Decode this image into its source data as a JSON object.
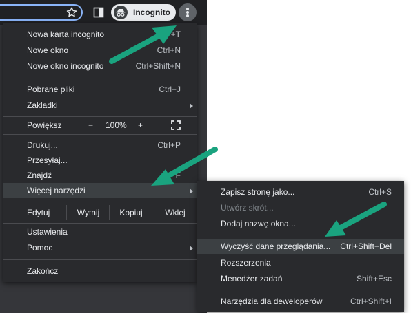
{
  "toolbar": {
    "incognito_label": "Incognito",
    "star_icon": "star-outline-icon",
    "side_panel_icon": "side-panel-icon",
    "incognito_icon": "incognito-icon",
    "menu_icon": "three-dots-vertical-icon"
  },
  "main_menu": {
    "new_incognito_tab": {
      "label": "Nowa karta incognito",
      "shortcut": "+T"
    },
    "new_window": {
      "label": "Nowe okno",
      "shortcut": "Ctrl+N"
    },
    "new_incognito_window": {
      "label": "Nowe okno incognito",
      "shortcut": "Ctrl+Shift+N"
    },
    "downloads": {
      "label": "Pobrane pliki",
      "shortcut": "Ctrl+J"
    },
    "bookmarks": {
      "label": "Zakładki"
    },
    "zoom": {
      "label": "Powiększ",
      "minus": "−",
      "value": "100%",
      "plus": "+"
    },
    "print": {
      "label": "Drukuj...",
      "shortcut": "Ctrl+P"
    },
    "cast": {
      "label": "Przesyłaj..."
    },
    "find": {
      "label": "Znajdź",
      "shortcut": "F"
    },
    "more_tools": {
      "label": "Więcej narzędzi"
    },
    "edit": {
      "label": "Edytuj",
      "cut": "Wytnij",
      "copy": "Kopiuj",
      "paste": "Wklej"
    },
    "settings": {
      "label": "Ustawienia"
    },
    "help": {
      "label": "Pomoc"
    },
    "exit": {
      "label": "Zakończ"
    }
  },
  "sub_menu": {
    "save_page": {
      "label": "Zapisz stronę jako...",
      "shortcut": "Ctrl+S"
    },
    "create_shortcut": {
      "label": "Utwórz skrót..."
    },
    "name_window": {
      "label": "Dodaj nazwę okna..."
    },
    "clear_data": {
      "label": "Wyczyść dane przeglądania...",
      "shortcut": "Ctrl+Shift+Del"
    },
    "extensions": {
      "label": "Rozszerzenia"
    },
    "task_manager": {
      "label": "Menedżer zadań",
      "shortcut": "Shift+Esc"
    },
    "dev_tools": {
      "label": "Narzędzia dla deweloperów",
      "shortcut": "Ctrl+Shift+I"
    }
  },
  "colors": {
    "menu_bg": "#292a2d",
    "highlight": "#3c4043",
    "arrow": "#1aa37f"
  }
}
